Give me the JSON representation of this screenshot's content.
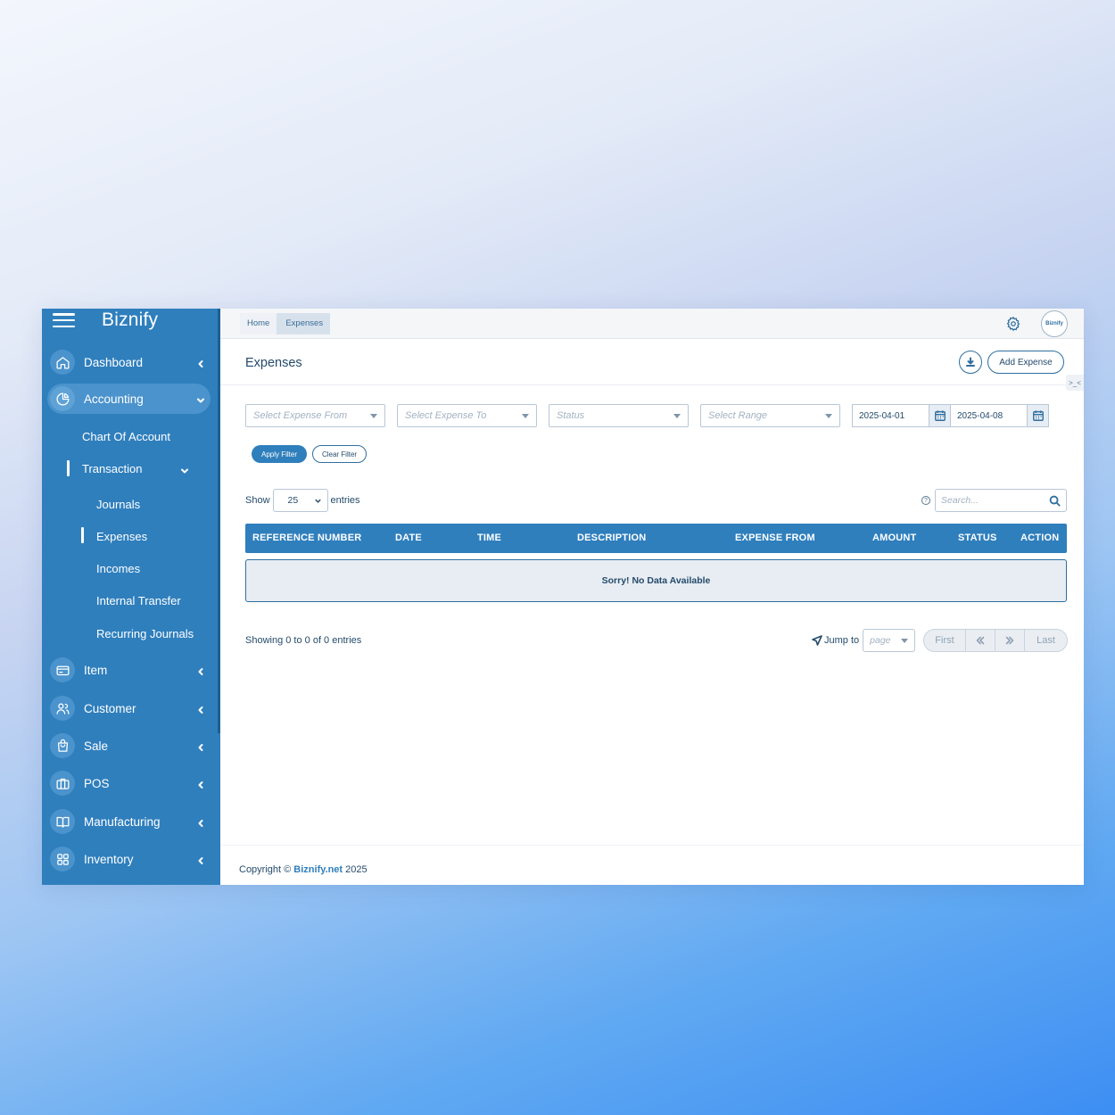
{
  "app": {
    "name": "Biznify"
  },
  "sidebar": {
    "items": [
      {
        "label": "Dashboard"
      },
      {
        "label": "Accounting"
      },
      {
        "label": "Item"
      },
      {
        "label": "Customer"
      },
      {
        "label": "Sale"
      },
      {
        "label": "POS"
      },
      {
        "label": "Manufacturing"
      },
      {
        "label": "Inventory"
      }
    ],
    "accounting_sub": {
      "chart_of_account": "Chart Of Account",
      "transaction": "Transaction",
      "transaction_sub": [
        "Journals",
        "Expenses",
        "Incomes",
        "Internal Transfer",
        "Recurring Journals"
      ]
    }
  },
  "breadcrumb": {
    "home": "Home",
    "current": "Expenses"
  },
  "header": {
    "avatar_text": "Biznify"
  },
  "page": {
    "title": "Expenses",
    "add_button": "Add Expense",
    "toggle_glyph": ">_<"
  },
  "filters": {
    "expense_from_placeholder": "Select Expense From",
    "expense_to_placeholder": "Select Expense To",
    "status_placeholder": "Status",
    "range_placeholder": "Select Range",
    "date_from": "2025-04-01",
    "date_to": "2025-04-08",
    "apply_label": "Apply Filter",
    "clear_label": "Clear Filter"
  },
  "table": {
    "show_label": "Show",
    "entries_value": "25",
    "entries_label": "entries",
    "search_placeholder": "Search...",
    "columns": [
      "REFERENCE NUMBER",
      "DATE",
      "TIME",
      "DESCRIPTION",
      "EXPENSE FROM",
      "AMOUNT",
      "STATUS",
      "ACTION"
    ],
    "empty_message": "Sorry! No Data Available",
    "showing_text": "Showing 0 to 0 of 0 entries"
  },
  "pagination": {
    "jump_label": "Jump to",
    "page_placeholder": "page",
    "first": "First",
    "last": "Last"
  },
  "footer": {
    "prefix": "Copyright © ",
    "link": "Biznify.net",
    "year": " 2025"
  },
  "colors": {
    "primary": "#2f7fbd",
    "text": "#244b6b"
  }
}
